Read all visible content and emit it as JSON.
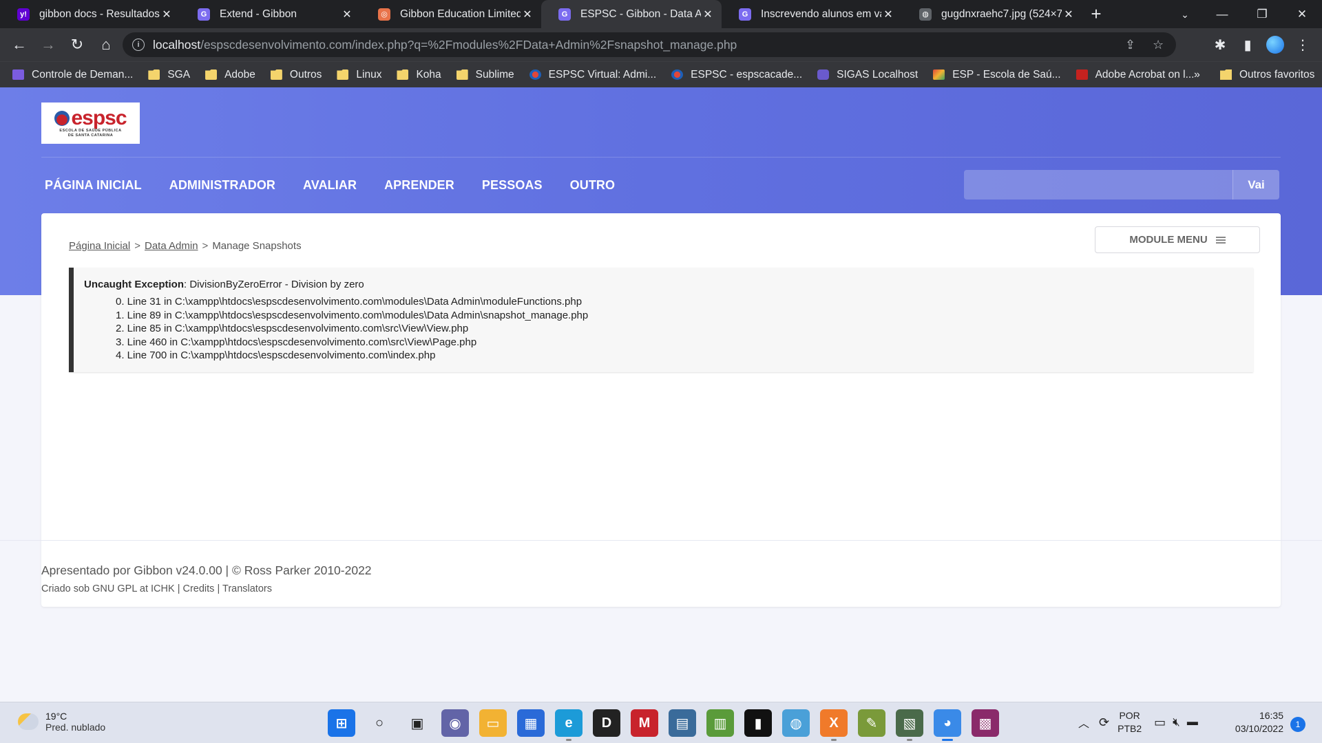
{
  "browser": {
    "tabs": [
      {
        "title": "gibbon docs - Resultados d",
        "favicon": "yahoo-icon",
        "color": "#6001d2",
        "glyph": "y!"
      },
      {
        "title": "Extend - Gibbon",
        "favicon": "gibbon-icon",
        "color": "#7c6cf0",
        "glyph": "G"
      },
      {
        "title": "Gibbon Education Limited",
        "favicon": "gibbon-edu-icon",
        "color": "#e8734a",
        "glyph": "◎"
      },
      {
        "title": "ESPSC - Gibbon - Data Adm",
        "favicon": "gibbon-icon",
        "color": "#7c6cf0",
        "glyph": "G"
      },
      {
        "title": "Inscrevendo alunos em vári",
        "favicon": "gibbon-icon",
        "color": "#7c6cf0",
        "glyph": "G"
      },
      {
        "title": "gugdnxraehc7.jpg (524×75",
        "favicon": "globe-icon",
        "color": "#5f6368",
        "glyph": "◍"
      }
    ],
    "active_tab": 3,
    "url_host": "localhost",
    "url_rest": "/espscdesenvolvimento.com/index.php?q=%2Fmodules%2FData+Admin%2Fsnapshot_manage.php"
  },
  "bookmarks": [
    {
      "label": "Controle de Deman...",
      "icon": "list"
    },
    {
      "label": "SGA",
      "icon": "folder"
    },
    {
      "label": "Adobe",
      "icon": "folder"
    },
    {
      "label": "Outros",
      "icon": "folder"
    },
    {
      "label": "Linux",
      "icon": "folder"
    },
    {
      "label": "Koha",
      "icon": "folder"
    },
    {
      "label": "Sublime",
      "icon": "folder"
    },
    {
      "label": "ESPSC Virtual: Admi...",
      "icon": "globe"
    },
    {
      "label": "ESPSC - espscacade...",
      "icon": "globe"
    },
    {
      "label": "SIGAS Localhost",
      "icon": "gib"
    },
    {
      "label": "ESP - Escola de Saú...",
      "icon": "esp"
    },
    {
      "label": "Adobe Acrobat on l...",
      "icon": "pdf"
    }
  ],
  "bookmarks_more": "»",
  "bookmarks_others": "Outros favoritos",
  "site": {
    "logo_word": "espsc",
    "logo_sub1": "ESCOLA DE SAÚDE PÚBLICA",
    "logo_sub2": "DE SANTA CATARINA",
    "nav": [
      "PÁGINA INICIAL",
      "ADMINISTRADOR",
      "AVALIAR",
      "APRENDER",
      "PESSOAS",
      "OUTRO"
    ],
    "search_button": "Vai",
    "search_value": ""
  },
  "breadcrumb": {
    "home": "Página Inicial",
    "module": "Data Admin",
    "current": "Manage Snapshots",
    "sep": ">"
  },
  "module_menu": "MODULE MENU",
  "error": {
    "label": "Uncaught Exception",
    "message": ": DivisionByZeroError - Division by zero",
    "trace": [
      "0. Line 31 in C:\\xampp\\htdocs\\espscdesenvolvimento.com\\modules\\Data Admin\\moduleFunctions.php",
      "1. Line 89 in C:\\xampp\\htdocs\\espscdesenvolvimento.com\\modules\\Data Admin\\snapshot_manage.php",
      "2. Line 85 in C:\\xampp\\htdocs\\espscdesenvolvimento.com\\src\\View\\View.php",
      "3. Line 460 in C:\\xampp\\htdocs\\espscdesenvolvimento.com\\src\\View\\Page.php",
      "4. Line 700 in C:\\xampp\\htdocs\\espscdesenvolvimento.com\\index.php"
    ]
  },
  "footer": {
    "line1": "Apresentado por Gibbon v24.0.00 | © Ross Parker 2010-2022",
    "line2_prefix": "Criado sob GNU GPL at ICHK | ",
    "credits": "Credits",
    "sep": " | ",
    "translators": "Translators"
  },
  "taskbar": {
    "temp": "19°C",
    "weather": "Pred. nublado",
    "lang1": "POR",
    "lang2": "PTB2",
    "time": "16:35",
    "date": "03/10/2022",
    "notifications": "1",
    "apps": [
      {
        "name": "start-icon",
        "color": "#1a73e8",
        "glyph": "⊞"
      },
      {
        "name": "search-icon",
        "color": "transparent",
        "glyph": "○"
      },
      {
        "name": "task-view-icon",
        "color": "transparent",
        "glyph": "▣"
      },
      {
        "name": "chat-icon",
        "color": "#6264a7",
        "glyph": "◉"
      },
      {
        "name": "file-explorer-icon",
        "color": "#f2b233",
        "glyph": "▭"
      },
      {
        "name": "store-icon",
        "color": "#2a6ad8",
        "glyph": "▦"
      },
      {
        "name": "edge-icon",
        "color": "#1c9bd8",
        "glyph": "e"
      },
      {
        "name": "dell-icon",
        "color": "#222222",
        "glyph": "D"
      },
      {
        "name": "mcafee-icon",
        "color": "#c8232c",
        "glyph": "M"
      },
      {
        "name": "app-icon",
        "color": "#3a6b9a",
        "glyph": "▤"
      },
      {
        "name": "spreadsheet-icon",
        "color": "#5a9b3a",
        "glyph": "▥"
      },
      {
        "name": "terminal-icon",
        "color": "#111111",
        "glyph": "▮"
      },
      {
        "name": "network-app-icon",
        "color": "#4aa0d8",
        "glyph": "◍"
      },
      {
        "name": "xampp-icon",
        "color": "#f07a2a",
        "glyph": "X"
      },
      {
        "name": "image-editor-icon",
        "color": "#7a9a3a",
        "glyph": "✎"
      },
      {
        "name": "calculator-icon",
        "color": "#4a6a4a",
        "glyph": "▧"
      },
      {
        "name": "chrome-icon",
        "color": "#3a8ae8",
        "glyph": "◕",
        "active": true
      },
      {
        "name": "winrar-icon",
        "color": "#8a2a6a",
        "glyph": "▩"
      }
    ]
  }
}
